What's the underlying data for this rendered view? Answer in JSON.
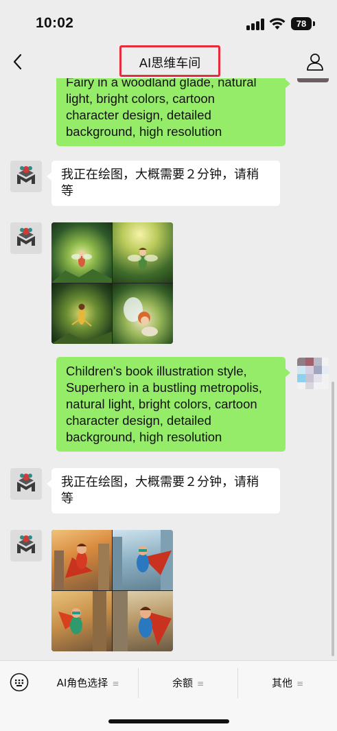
{
  "status_bar": {
    "time": "10:02",
    "battery": "78",
    "icons": [
      "signal-icon",
      "wifi-icon",
      "battery-icon"
    ]
  },
  "nav": {
    "title": "AI思维车间",
    "back_icon": "chevron-left-icon",
    "profile_icon": "person-icon",
    "highlight_color": "#e52b3c"
  },
  "messages": [
    {
      "sender": "user",
      "lines": [
        "Fairy in a woodland glade, natural",
        "light, bright colors, cartoon",
        "character design, detailed",
        "background, high resolution"
      ]
    },
    {
      "sender": "bot",
      "lines": [
        "我正在绘图，大概需要２分钟，请稍",
        "等"
      ]
    },
    {
      "sender": "bot",
      "image": "fairy-image-grid"
    },
    {
      "sender": "user",
      "lines": [
        "Children's book illustration style,",
        "Superhero in a bustling metropolis,",
        "natural light, bright colors, cartoon",
        "character design, detailed",
        "background, high resolution"
      ]
    },
    {
      "sender": "bot",
      "lines": [
        "我正在绘图，大概需要２分钟，请稍",
        "等"
      ]
    },
    {
      "sender": "bot",
      "image": "superhero-image-grid"
    }
  ],
  "bottom_menu": {
    "keyboard_icon": "keyboard-icon",
    "items": [
      {
        "label": "AI角色选择"
      },
      {
        "label": "余额"
      },
      {
        "label": "其他"
      }
    ]
  },
  "colors": {
    "background": "#ededed",
    "user_bubble": "#95ec69",
    "bot_bubble": "#ffffff"
  }
}
